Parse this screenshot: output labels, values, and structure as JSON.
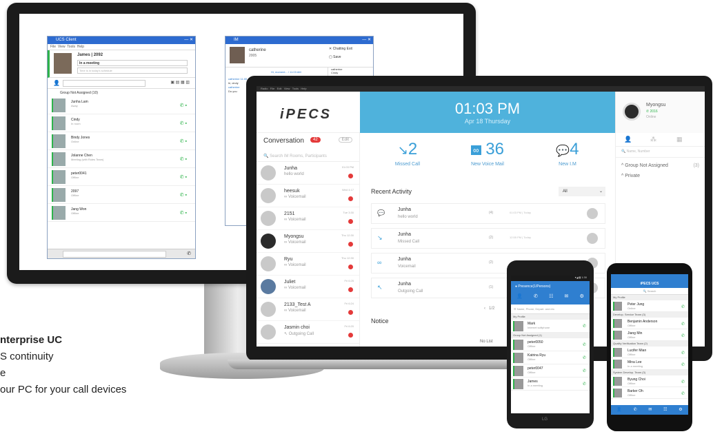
{
  "desktop_client": {
    "title": "UCS Client",
    "menu": [
      "File",
      "View",
      "Tools",
      "Help"
    ],
    "user_name": "James | 2092",
    "status_text": "In a meeting",
    "status_placeholder": "Time is in today's schedule",
    "group_header": "Group Not Assigned (10)",
    "contacts": [
      {
        "name": "Junha Lam",
        "status": "Away"
      },
      {
        "name": "Cindy",
        "status": "In room"
      },
      {
        "name": "Bindy Jones",
        "status": "Online"
      },
      {
        "name": "Jolanne Chen",
        "status": "Meeting (with Roles Team)"
      },
      {
        "name": "peter0041",
        "status": "Offline"
      },
      {
        "name": "2097",
        "status": "Offline"
      },
      {
        "name": "Jang Won",
        "status": "Offline"
      }
    ]
  },
  "chat_window": {
    "title": "IM",
    "contact_name": "catherine",
    "contact_ext": "2005",
    "actions": [
      "Chatting Exit",
      "Save"
    ],
    "messages": [
      "Hi, moment... / 11:03 AM",
      "catherine 11:05 AM",
      "hi, cindy",
      "catherine",
      "Do you"
    ],
    "participants": [
      "catherine",
      "Cindy"
    ]
  },
  "laptop_app": {
    "menu": [
      "Radio",
      "File",
      "Edit",
      "View",
      "Tools",
      "Help"
    ],
    "logo": "iPECS",
    "time": "01:03 PM",
    "date": "Apr 18 Thursday",
    "user": {
      "name": "Myongsu",
      "ext": "2016",
      "status": "Online"
    },
    "conversation": {
      "title": "Conversation",
      "badge": "42",
      "edit": "Edit",
      "search_placeholder": "Search IM Rooms, Participants",
      "items": [
        {
          "name": "Junha",
          "sub": "hello world",
          "date": "01:03 PM"
        },
        {
          "name": "heesuk",
          "sub": "Voicemail",
          "date": "Wed 4:17"
        },
        {
          "name": "2151",
          "sub": "Voicemail",
          "date": "Tue 3:30"
        },
        {
          "name": "Myongsu",
          "sub": "Voicemail",
          "date": "Thu 12:30"
        },
        {
          "name": "Ryu",
          "sub": "Voicemail",
          "date": "Thu 12:30"
        },
        {
          "name": "Juliet",
          "sub": "Voicemail",
          "date": "Fri 6:25"
        },
        {
          "name": "2133_Test A",
          "sub": "Voicemail",
          "date": "Fri 6:24"
        },
        {
          "name": "Jasmin choi",
          "sub": "Outgoing Call",
          "date": "Fri 6:20"
        }
      ]
    },
    "stats": [
      {
        "icon": "missed-call-icon",
        "value": "2",
        "label": "Missed Call"
      },
      {
        "icon": "voicemail-icon",
        "value": "36",
        "label": "New Voice Mail"
      },
      {
        "icon": "chat-bubble-icon",
        "value": "4",
        "label": "New I.M"
      }
    ],
    "recent": {
      "title": "Recent Activity",
      "filter": "All",
      "items": [
        {
          "name": "Junha",
          "sub": "hello world",
          "count": "(4)",
          "time": "01:03 PM | Today"
        },
        {
          "name": "Junha",
          "sub": "Missed Call",
          "count": "(2)",
          "time": "12:55 PM | Today"
        },
        {
          "name": "Junha",
          "sub": "Voicemail",
          "count": "(2)",
          "time": ""
        },
        {
          "name": "Junha",
          "sub": "Outgoing Call",
          "count": "(1)",
          "time": ""
        }
      ],
      "page": "1/2"
    },
    "notice": {
      "title": "Notice",
      "empty": "No List"
    },
    "right_panel": {
      "search_placeholder": "Name, Number",
      "groups": [
        {
          "name": "Group Not Assigned",
          "count": "(3)"
        },
        {
          "name": "Private",
          "count": ""
        }
      ]
    }
  },
  "phone_left": {
    "title": "Presence(1/Persons)",
    "search_placeholder": "Name, Phone, Depart. and etc.",
    "tabs": [
      "Presence",
      "Call",
      "Call Log",
      "Messages",
      "Settings"
    ],
    "my_profile_label": "My Profile",
    "me": {
      "name": "Mark",
      "status": "Internet softphone"
    },
    "group": "Group Not Assigned (1)",
    "contacts": [
      {
        "name": "peter0050",
        "status": "Offline"
      },
      {
        "name": "Katrina Ryu",
        "status": "Offline"
      },
      {
        "name": "peter0047",
        "status": "Offline"
      },
      {
        "name": "James",
        "status": "In a meeting"
      }
    ],
    "footer": "LG"
  },
  "phone_right": {
    "title": "iPECS UCS",
    "search_placeholder": "Search",
    "groups": [
      {
        "name": "My Profile",
        "contacts": [
          {
            "name": "Peter Jung",
            "status": "Online"
          }
        ]
      },
      {
        "name": "Develop. Service Team (3)",
        "contacts": [
          {
            "name": "Benjamin Anderson",
            "status": "Offline"
          },
          {
            "name": "Jiang Min",
            "status": "Offline"
          }
        ]
      },
      {
        "name": "Quality Verification Team (2)",
        "contacts": [
          {
            "name": "Lucifer Mian",
            "status": "Offline"
          },
          {
            "name": "Mina Lee",
            "status": "In a meeting"
          }
        ]
      },
      {
        "name": "System Develop. Team (3)",
        "contacts": [
          {
            "name": "Byung Choi",
            "status": "Offline"
          },
          {
            "name": "Barker Oh",
            "status": "Offline"
          }
        ]
      }
    ]
  },
  "bullets": [
    "nterprise UC",
    "S continuity",
    "e",
    "our PC for your call devices"
  ],
  "colors": {
    "accent": "#4fb2dc",
    "online": "#2db34a",
    "badge": "#e43a3a"
  }
}
